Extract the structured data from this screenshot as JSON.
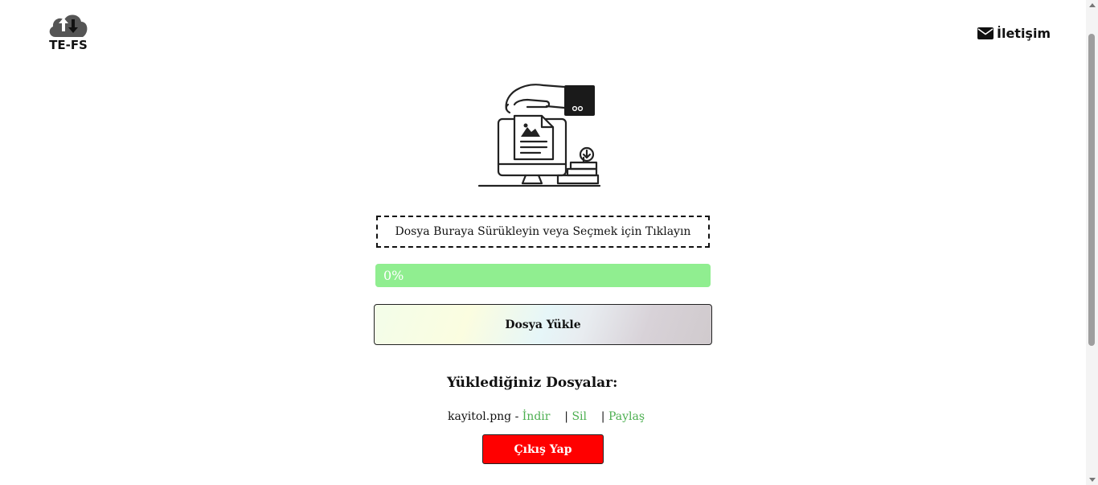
{
  "header": {
    "logo_text": "TE-FS",
    "logo_icon": "cloud-upload-download-icon",
    "contact_label": "İletişim",
    "contact_icon": "envelope-icon"
  },
  "hero": {
    "illustration_icon": "hand-file-computer-illustration"
  },
  "upload": {
    "dropzone_text": "Dosya Buraya Sürükleyin veya Seçmek için Tıklayın",
    "progress_label": "0%",
    "progress_value": 0,
    "upload_button_label": "Dosya Yükle"
  },
  "files": {
    "title": "Yüklediğiniz Dosyalar:",
    "items": [
      {
        "name": "kayitol.png",
        "separator": " - ",
        "download_label": "İndir",
        "delete_label": "Sil",
        "share_label": "Paylaş"
      }
    ]
  },
  "logout_label": "Çıkış Yap",
  "colors": {
    "progress_fill": "#90ee90",
    "link": "#4caf50",
    "logout_bg": "#ff0000"
  }
}
